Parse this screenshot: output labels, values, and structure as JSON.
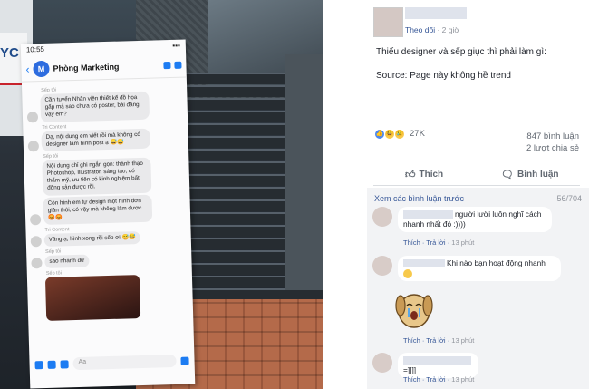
{
  "phone": {
    "time": "10:55",
    "chat_title": "Phòng Marketing",
    "avatar_letter": "M",
    "input_placeholder": "Aa",
    "messages": [
      {
        "sender": "Sếp tôi",
        "text": "Cần tuyển Nhân viên thiết kế đồ họa gấp mà sao chưa có poster, bài đăng vậy em?"
      },
      {
        "sender": "Tri Content",
        "text": "Dạ, nội dung em viết rồi mà không có designer làm hình post ạ 😅😅"
      },
      {
        "sender": "Sếp tôi",
        "text": "Nội dung chỉ ghi ngắn gọn: thành thạo Photoshop, Illustrator, sáng tạo, có thẩm mỹ, ưu tiên có kinh nghiệm bất động sản được rồi."
      },
      {
        "sender": "",
        "text": "Còn hình em tự design một hình đơn giản thôi, có vậy mà không làm được 😡😡"
      },
      {
        "sender": "Tri Content",
        "text": "Vâng ạ, hình xong rồi sếp ơi 😅😅"
      },
      {
        "sender": "Sếp tôi",
        "text": "sao nhanh dữ"
      },
      {
        "sender": "Sếp tôi",
        "text": ""
      }
    ]
  },
  "sign_text": "YC",
  "post": {
    "follow_label": "Theo dõi",
    "time_label": "2 giờ",
    "line1": "Thiếu designer và sếp giục thì phải làm gì:",
    "line2": "Source: Page này không hề trend",
    "reaction_count": "27K",
    "comment_count": "847 bình luận",
    "share_count": "2 lượt chia sẻ",
    "like_label": "Thích",
    "comment_label": "Bình luận"
  },
  "comments": {
    "more_label": "Xem các bình luận trước",
    "pages": "56/704",
    "items": [
      {
        "text": "người lười luôn nghĩ cách nhanh nhất đó :))))",
        "like": "Thích",
        "reply": "Trả lời",
        "time": "13 phút"
      },
      {
        "text": "Khi nào bạn hoạt động nhanh",
        "like": "Thích",
        "reply": "Trả lời",
        "time": "13 phút"
      },
      {
        "text": "=]]]]",
        "like": "Thích",
        "reply": "Trả lời",
        "time": "13 phút"
      }
    ]
  },
  "colors": {
    "fb_blue": "#385898",
    "messenger_blue": "#1d7cf2",
    "comment_bg": "#f2f3f5"
  },
  "icons": [
    "back-icon",
    "call-icon",
    "video-icon",
    "camera-icon",
    "image-icon",
    "mic-icon",
    "emoji-icon",
    "like-icon",
    "comment-icon"
  ]
}
